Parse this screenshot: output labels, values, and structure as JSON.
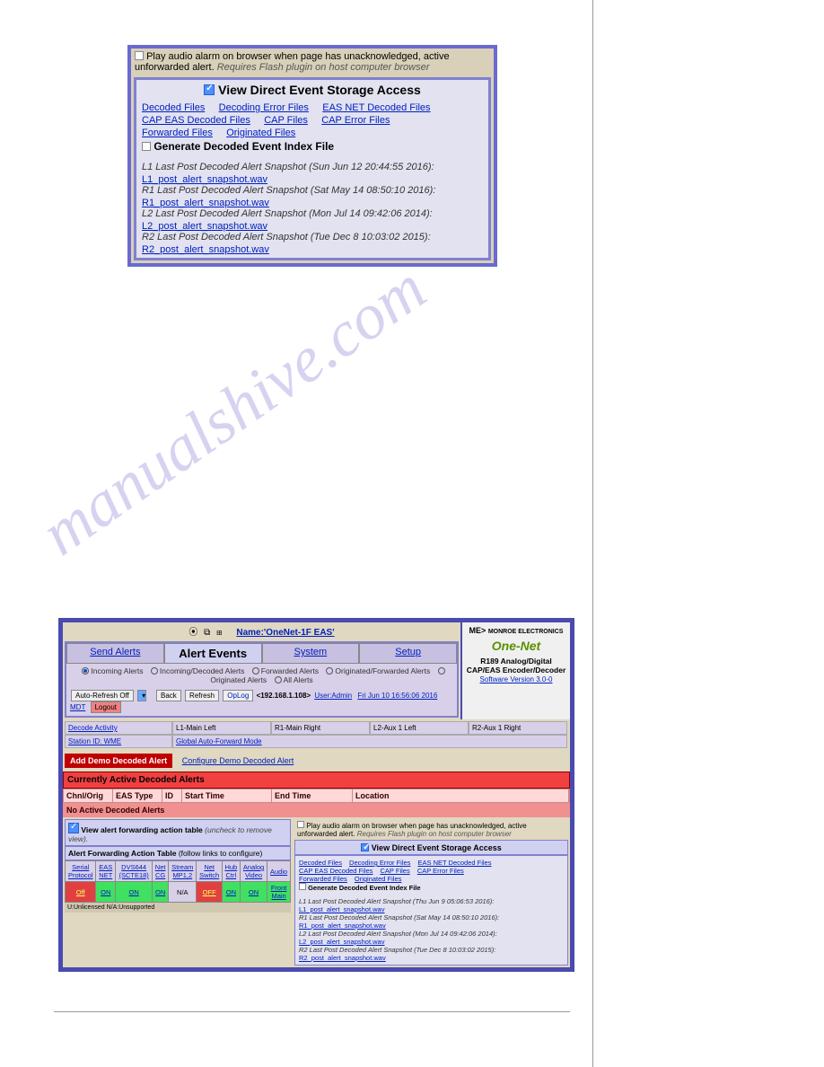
{
  "watermark": "manualshive.com",
  "top_panel": {
    "audio_alarm_label": "Play audio alarm on browser when page has unacknowledged, active unforwarded alert.",
    "audio_alarm_req": "Requires Flash plugin on host computer browser",
    "view_header": "View  Direct Event Storage Access",
    "file_links": [
      "Decoded Files",
      "Decoding Error Files",
      "EAS NET Decoded Files",
      "CAP EAS Decoded Files",
      "CAP Files",
      "CAP Error Files",
      "Forwarded Files",
      "Originated Files"
    ],
    "gen_index_label": "Generate Decoded Event Index File",
    "snapshots": [
      {
        "label": "L1 Last Post Decoded Alert Snapshot (Sun Jun 12 20:44:55 2016):",
        "link": "L1_post_alert_snapshot.wav"
      },
      {
        "label": "R1 Last Post Decoded Alert Snapshot (Sat May 14 08:50:10 2016):",
        "link": "R1_post_alert_snapshot.wav"
      },
      {
        "label": "L2 Last Post Decoded Alert Snapshot (Mon Jul 14 09:42:06 2014):",
        "link": "L2_post_alert_snapshot.wav"
      },
      {
        "label": "R2 Last Post Decoded Alert Snapshot (Tue Dec 8 10:03:02 2015):",
        "link": "R2_post_alert_snapshot.wav"
      }
    ]
  },
  "app": {
    "name_label": "Name:'OneNet-1F EAS'",
    "tabs": {
      "send": "Send Alerts",
      "events": "Alert Events",
      "system": "System",
      "setup": "Setup"
    },
    "radios": [
      "Incoming Alerts",
      "Incoming/Decoded Alerts",
      "Forwarded Alerts",
      "Originated/Forwarded Alerts",
      "Originated Alerts",
      "All Alerts"
    ],
    "radio_selected": 0,
    "toolbar": {
      "auto_refresh": "Auto-Refresh Off",
      "back": "Back",
      "refresh": "Refresh",
      "oplog": "OpLog",
      "ip": "<192.168.1.108>",
      "user": "User:Admin",
      "datetime": "Fri Jun 10 16:56:06 2016 MDT",
      "logout": "Logout"
    },
    "decode_cols": [
      "Decode Activity",
      "L1-Main Left",
      "R1-Main Right",
      "L2-Aux 1 Left",
      "R2-Aux 1 Right"
    ],
    "station_row": {
      "station": "Station ID: WME",
      "gaf": "Global Auto-Forward Mode"
    },
    "demo_btn": "Add Demo Decoded Alert",
    "cfg_demo": "Configure Demo Decoded Alert",
    "curr_header": "Currently Active Decoded Alerts",
    "th": [
      "Chnl/Orig",
      "EAS Type",
      "ID",
      "Start Time",
      "End Time",
      "Location"
    ],
    "no_alerts": "No Active Decoded Alerts",
    "view_fwd_chk": "View alert forwarding action table",
    "view_fwd_note": "(uncheck to remove view).",
    "fwd_head": "Alert Forwarding Action Table",
    "fwd_head_note": "(follow links to configure)",
    "fwd_th": [
      "Serial Protocol",
      "EAS NET",
      "DVS644 (SCTE18)",
      "Net CG",
      "Stream MP1,2",
      "Net Switch",
      "Hub Ctrl",
      "Analog Video",
      "Audio"
    ],
    "fwd_row": [
      "Off",
      "ON",
      "ON",
      "ON",
      "N/A",
      "OFF",
      "ON",
      "ON",
      "Front Main"
    ],
    "unlic": "U:Unlicensed N/A:Unsupported",
    "r_audio_label": "Play audio alarm on browser when page has unacknowledged, active unforwarded alert.",
    "r_audio_req": "Requires Flash plugin on host computer browser",
    "r_view_header": "View  Direct Event Storage Access",
    "r_links": [
      "Decoded Files",
      "Decoding Error Files",
      "EAS NET Decoded Files",
      "CAP EAS Decoded Files",
      "CAP Files",
      "CAP Error Files",
      "Forwarded Files",
      "Originated Files"
    ],
    "r_gen_index": "Generate Decoded Event Index File",
    "r_snapshots": [
      {
        "label": "L1 Last Post Decoded Alert Snapshot (Thu Jun 9 05:06:53 2016):",
        "link": "L1_post_alert_snapshot.wav"
      },
      {
        "label": "R1 Last Post Decoded Alert Snapshot (Sat May 14 08:50:10 2016):",
        "link": "R1_post_alert_snapshot.wav"
      },
      {
        "label": "L2 Last Post Decoded Alert Snapshot (Mon Jul 14 09:42:06 2014):",
        "link": "L2_post_alert_snapshot.wav"
      },
      {
        "label": "R2 Last Post Decoded Alert Snapshot (Tue Dec 8 10:03:02 2015):",
        "link": "R2_post_alert_snapshot.wav"
      }
    ],
    "brand_top": "MONROE ELECTRONICS",
    "brand_mid": "One-Net",
    "brand_sub": "R189 Analog/Digital CAP/EAS Encoder/Decoder",
    "sw": "Software Version 3.0-0"
  }
}
